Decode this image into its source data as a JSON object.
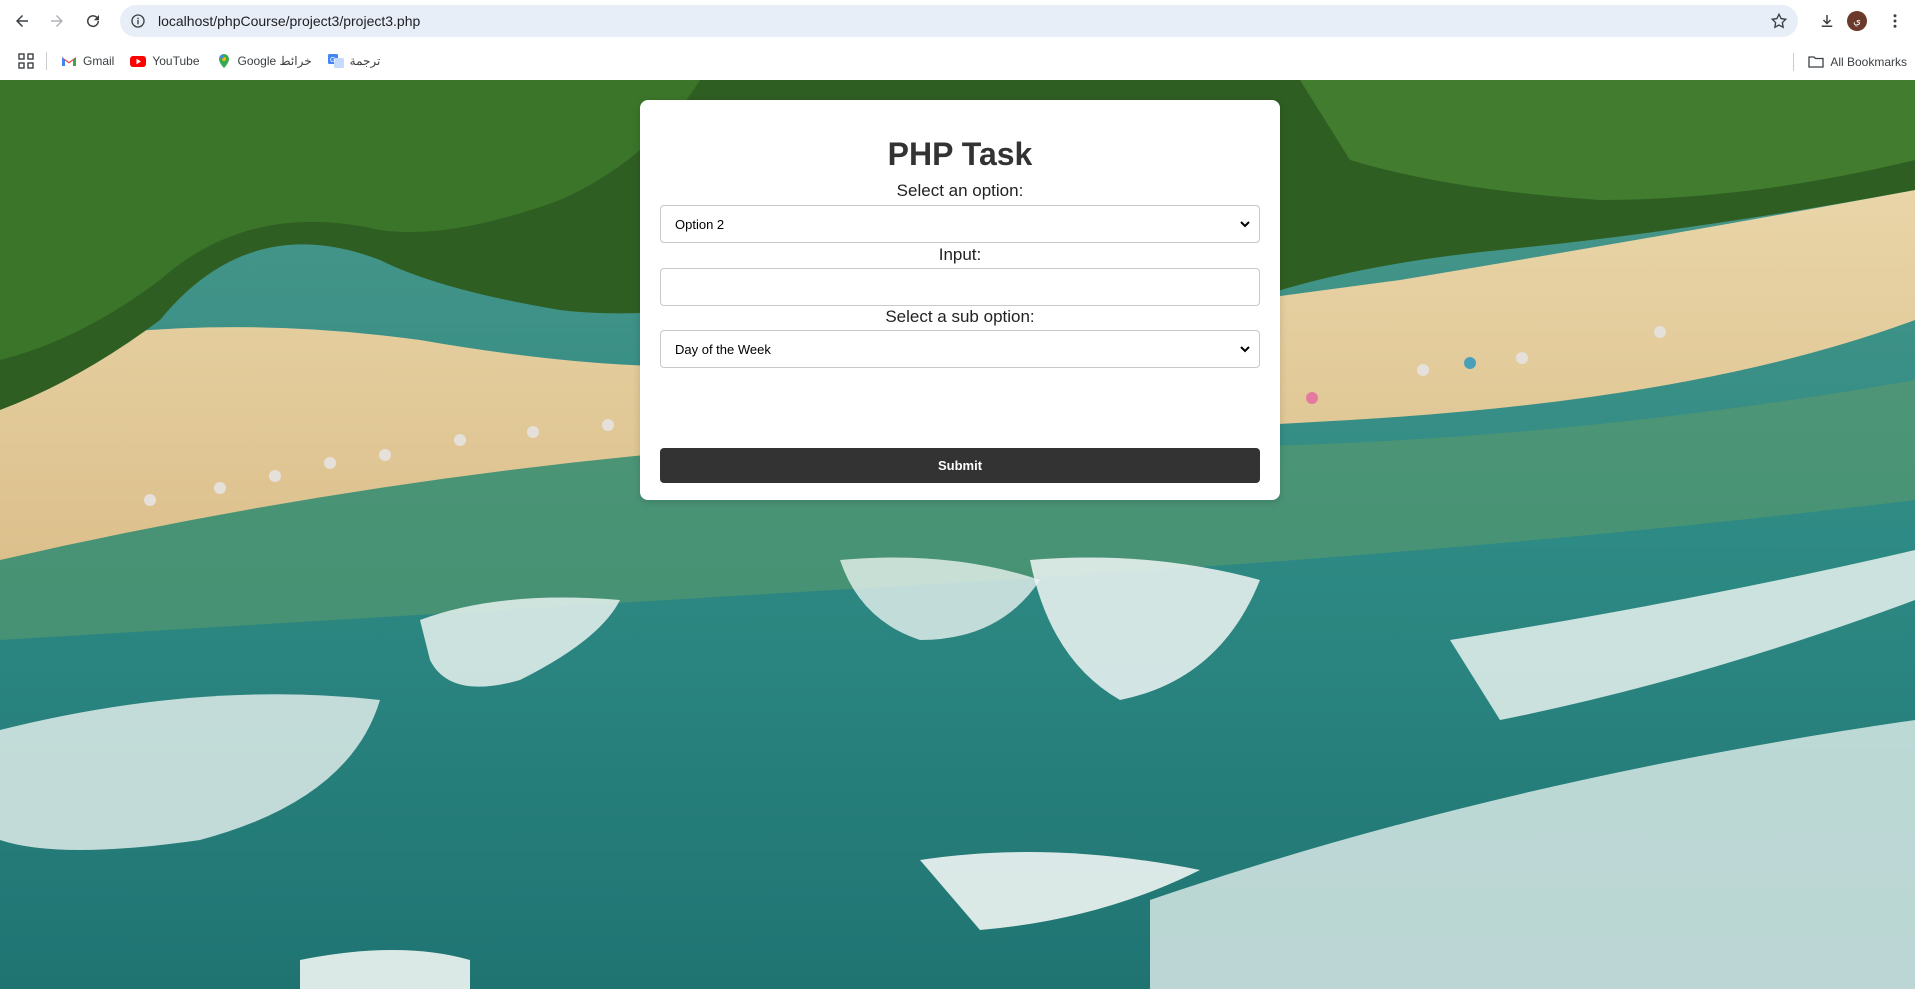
{
  "browser": {
    "url": "localhost/phpCourse/project3/project3.php",
    "avatar_initial": "ي",
    "bookmarks": [
      {
        "label": "Gmail",
        "icon": "gmail-icon"
      },
      {
        "label": "YouTube",
        "icon": "youtube-icon"
      },
      {
        "label": "Google خرائط",
        "icon": "maps-icon"
      },
      {
        "label": "ترجمة",
        "icon": "translate-icon"
      }
    ],
    "all_bookmarks": "All Bookmarks"
  },
  "form": {
    "title": "PHP Task",
    "option_label": "Select an option:",
    "option_value": "Option 2",
    "input_label": "Input:",
    "input_value": "",
    "sub_option_label": "Select a sub option:",
    "sub_option_value": "Day of the Week",
    "submit_label": "Submit"
  },
  "colors": {
    "button_bg": "#333333",
    "omnibox_bg": "#e8eef7",
    "card_bg": "#ffffff"
  }
}
